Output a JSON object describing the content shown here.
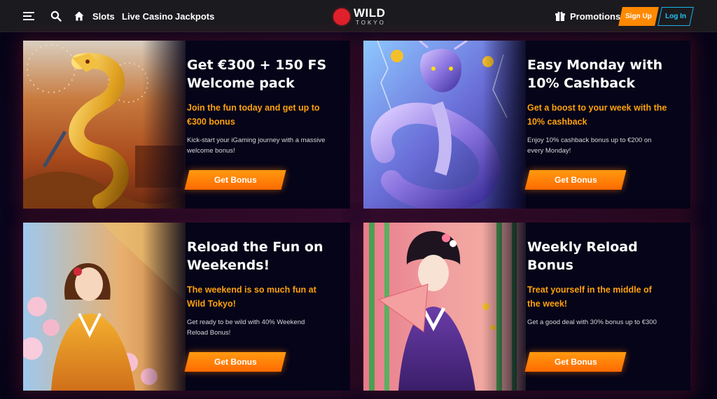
{
  "header": {
    "menu_icon": "hamburger-icon",
    "search_icon": "search-icon",
    "home_icon": "home-icon",
    "nav": [
      "Slots",
      "Live Casino",
      "Jackpots"
    ],
    "logo_top": "WILD",
    "logo_bottom": "TOKYO",
    "promotions_label": "Promotions",
    "promotions_icon": "gift-icon",
    "signup_label": "Sign Up",
    "login_label": "Log In"
  },
  "colors": {
    "accent_orange": "#ff8a00",
    "login_blue": "#25c3f0",
    "subtitle_orange": "#ffa10a",
    "logo_red": "#e0202a"
  },
  "promos": [
    {
      "title": "Get €300 + 150 FS Welcome pack",
      "subtitle": "Join the fun today and get up to €300 bonus",
      "description": "Kick-start your iGaming journey with a massive welcome bonus!",
      "button": "Get Bonus",
      "art": "golden-dragon"
    },
    {
      "title": "Easy Monday with 10% Cashback",
      "subtitle": "Get a boost to your week with the 10% cashback",
      "description": "Enjoy 10% cashback bonus up to €200 on every Monday!",
      "button": "Get Bonus",
      "art": "blue-dragon"
    },
    {
      "title": "Reload the Fun on Weekends!",
      "subtitle": "The weekend is so much fun at Wild Tokyo!",
      "description": "Get ready to be wild with 40% Weekend Reload Bonus!",
      "button": "Get Bonus",
      "art": "girl-with-umbrella"
    },
    {
      "title": "Weekly Reload Bonus",
      "subtitle": "Treat yourself in the middle of the week!",
      "description": "Get a good deal with 30% bonus up to €300",
      "button": "Get Bonus",
      "art": "geisha-with-fan"
    }
  ]
}
